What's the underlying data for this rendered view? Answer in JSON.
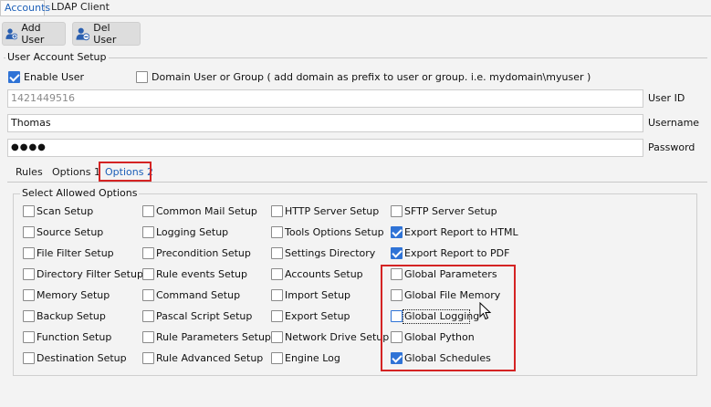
{
  "top_tabs": [
    {
      "label": "Accounts",
      "active": true
    },
    {
      "label": "LDAP Client",
      "active": false
    }
  ],
  "toolbar": {
    "add_user": "Add User",
    "del_user": "Del User"
  },
  "account_setup": {
    "group_title": "User Account Setup",
    "enable_user": {
      "label": "Enable User",
      "checked": true
    },
    "domain_user": {
      "label": "Domain User or Group ( add domain as prefix to user or group. i.e. mydomain\\myuser )",
      "checked": false
    },
    "user_id": {
      "value": "1421449516",
      "label": "User ID"
    },
    "username": {
      "value": "Thomas",
      "label": "Username"
    },
    "password": {
      "value": "●●●●",
      "label": "Password"
    }
  },
  "sub_tabs": [
    {
      "label": "Rules",
      "active": false
    },
    {
      "label": "Options 1",
      "active": false
    },
    {
      "label": "Options 2",
      "active": true
    }
  ],
  "options": {
    "group_title": "Select Allowed Options",
    "col1": [
      {
        "label": "Scan Setup",
        "checked": false
      },
      {
        "label": "Source Setup",
        "checked": false
      },
      {
        "label": "File Filter Setup",
        "checked": false
      },
      {
        "label": "Directory Filter Setup",
        "checked": false
      },
      {
        "label": "Memory Setup",
        "checked": false
      },
      {
        "label": "Backup Setup",
        "checked": false
      },
      {
        "label": "Function Setup",
        "checked": false
      },
      {
        "label": "Destination Setup",
        "checked": false
      }
    ],
    "col2": [
      {
        "label": "Common Mail Setup",
        "checked": false
      },
      {
        "label": "Logging Setup",
        "checked": false
      },
      {
        "label": "Precondition Setup",
        "checked": false
      },
      {
        "label": "Rule events Setup",
        "checked": false
      },
      {
        "label": "Command Setup",
        "checked": false
      },
      {
        "label": "Pascal Script Setup",
        "checked": false
      },
      {
        "label": "Rule Parameters Setup",
        "checked": false
      },
      {
        "label": "Rule Advanced Setup",
        "checked": false
      }
    ],
    "col3": [
      {
        "label": "HTTP Server Setup",
        "checked": false
      },
      {
        "label": "Tools Options Setup",
        "checked": false
      },
      {
        "label": "Settings Directory",
        "checked": false
      },
      {
        "label": "Accounts Setup",
        "checked": false
      },
      {
        "label": "Import Setup",
        "checked": false
      },
      {
        "label": "Export Setup",
        "checked": false
      },
      {
        "label": "Network Drive Setup",
        "checked": false
      },
      {
        "label": "Engine Log",
        "checked": false
      }
    ],
    "col4": [
      {
        "label": "SFTP Server Setup",
        "checked": false
      },
      {
        "label": "Export Report to HTML",
        "checked": true
      },
      {
        "label": "Export Report to PDF",
        "checked": true
      },
      {
        "label": "Global Parameters",
        "checked": false
      },
      {
        "label": "Global File Memory",
        "checked": false
      },
      {
        "label": "Global Logging",
        "checked": false
      },
      {
        "label": "Global Python",
        "checked": false
      },
      {
        "label": "Global Schedules",
        "checked": true
      }
    ]
  },
  "colors": {
    "accent": "#2f73d6",
    "highlight": "#d42323"
  }
}
